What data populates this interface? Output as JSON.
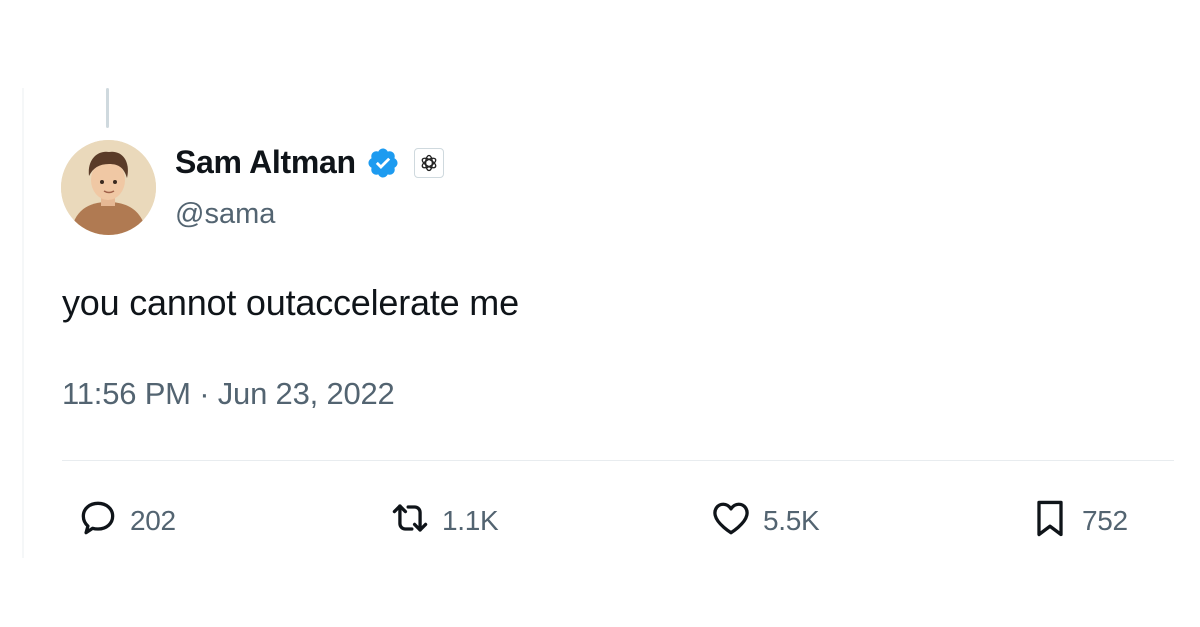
{
  "tweet": {
    "author": {
      "display_name": "Sam Altman",
      "handle": "@sama",
      "verified": true,
      "affiliation_icon": "openai-logo-icon"
    },
    "text": "you cannot outaccelerate me",
    "timestamp": "11:56 PM · Jun 23, 2022",
    "metrics": {
      "replies": "202",
      "reposts": "1.1K",
      "likes": "5.5K",
      "bookmarks": "752"
    }
  },
  "colors": {
    "text_primary": "#0f1419",
    "text_secondary": "#536471",
    "verified_blue": "#1d9bf0",
    "divider": "#e8ecef",
    "thread_line": "#cfd9de"
  },
  "icons": {
    "reply": "speech-bubble-icon",
    "repost": "repost-arrows-icon",
    "like": "heart-icon",
    "bookmark": "bookmark-icon",
    "verified": "verified-badge-icon"
  }
}
